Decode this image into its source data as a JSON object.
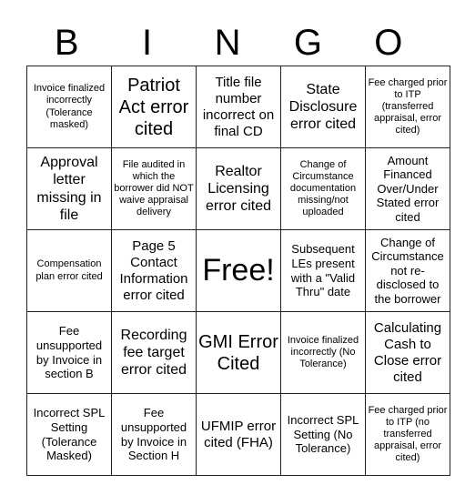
{
  "header": [
    "B",
    "I",
    "N",
    "G",
    "O"
  ],
  "cells": [
    [
      "Invoice finalized incorrectly (Tolerance masked)",
      "Patriot Act error cited",
      "Title file number incorrect on final CD",
      "State Disclosure error cited",
      "Fee charged prior to ITP (transferred appraisal, error cited)"
    ],
    [
      "Approval letter missing in file",
      "File audited in which the borrower did NOT waive appraisal delivery",
      "Realtor Licensing error cited",
      "Change of Circumstance documentation missing/not uploaded",
      "Amount Financed Over/Under Stated error cited"
    ],
    [
      "Compensation plan error cited",
      "Page 5 Contact Information error cited",
      "Free!",
      "Subsequent LEs present with a \"Valid Thru\" date",
      "Change of Circumstance not re-disclosed to the borrower"
    ],
    [
      "Fee unsupported by Invoice in section B",
      "Recording fee target error cited",
      "GMI Error Cited",
      "Invoice finalized incorrectly (No Tolerance)",
      "Calculating Cash to Close error cited"
    ],
    [
      "Incorrect SPL Setting (Tolerance Masked)",
      "Fee unsupported by Invoice in Section H",
      "UFMIP error cited (FHA)",
      "Incorrect SPL Setting (No Tolerance)",
      "Fee charged prior to ITP (no transferred appraisal, error cited)"
    ]
  ]
}
